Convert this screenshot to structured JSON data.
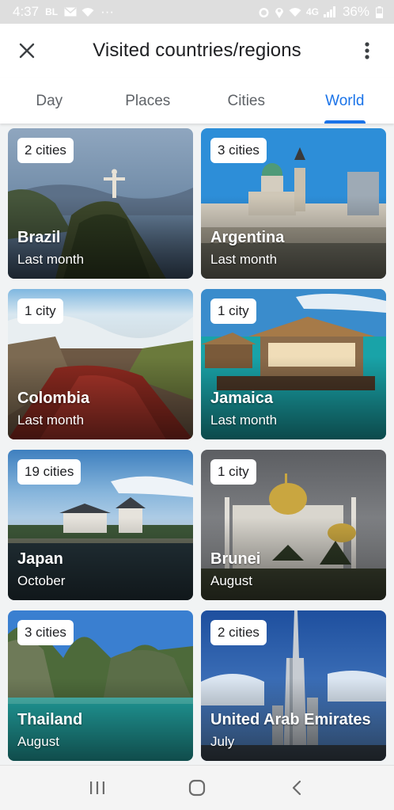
{
  "status_bar": {
    "time": "4:37",
    "carrier": "BL",
    "dots": "···",
    "battery": "36%",
    "network": "4G"
  },
  "header": {
    "title": "Visited countries/regions"
  },
  "tabs": [
    {
      "label": "Day",
      "active": false
    },
    {
      "label": "Places",
      "active": false
    },
    {
      "label": "Cities",
      "active": false
    },
    {
      "label": "World",
      "active": true
    }
  ],
  "countries": [
    {
      "name": "Brazil",
      "when": "Last month",
      "badge": "2 cities"
    },
    {
      "name": "Argentina",
      "when": "Last month",
      "badge": "3 cities"
    },
    {
      "name": "Colombia",
      "when": "Last month",
      "badge": "1 city"
    },
    {
      "name": "Jamaica",
      "when": "Last month",
      "badge": "1 city"
    },
    {
      "name": "Japan",
      "when": "October",
      "badge": "19 cities"
    },
    {
      "name": "Brunei",
      "when": "August",
      "badge": "1 city"
    },
    {
      "name": "Thailand",
      "when": "August",
      "badge": "3 cities"
    },
    {
      "name": "United Arab Emirates",
      "when": "July",
      "badge": "2 cities"
    }
  ],
  "colors": {
    "accent": "#1a73e8",
    "tab_inactive": "#5f6368",
    "title": "#202124"
  },
  "icons": {
    "close": "close-icon",
    "more": "more-vert-icon"
  }
}
